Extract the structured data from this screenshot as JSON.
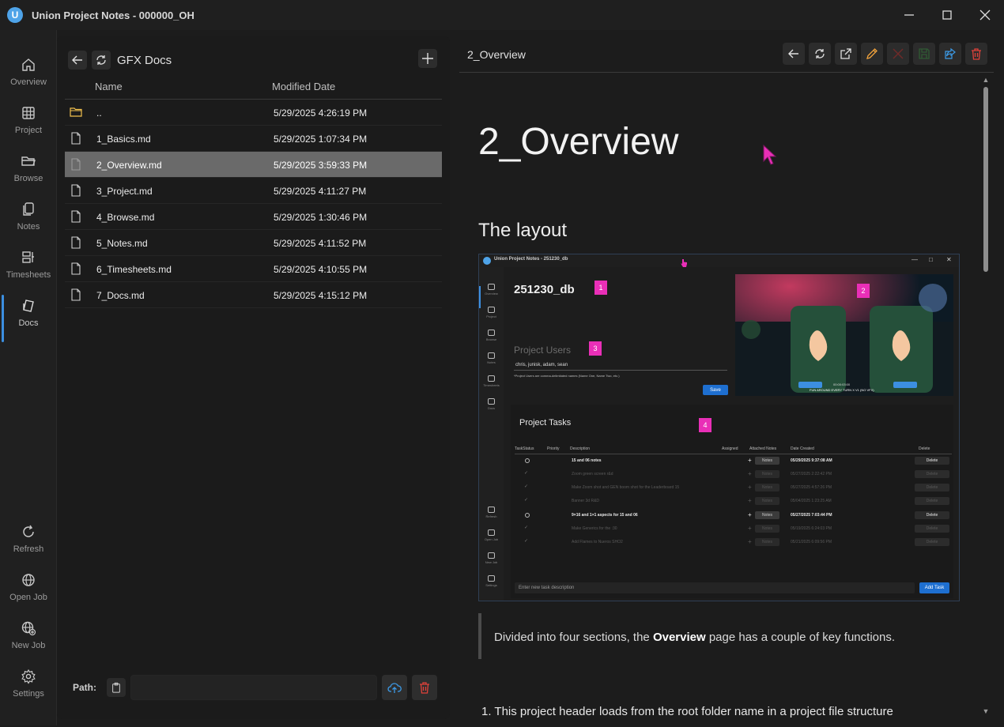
{
  "window": {
    "title": "Union Project Notes - 000000_OH",
    "logo_letter": "U"
  },
  "nav": [
    {
      "label": "Overview",
      "icon": "home-icon"
    },
    {
      "label": "Project",
      "icon": "grid-icon"
    },
    {
      "label": "Browse",
      "icon": "folder-open-icon"
    },
    {
      "label": "Notes",
      "icon": "notes-icon"
    },
    {
      "label": "Timesheets",
      "icon": "timesheets-icon"
    },
    {
      "label": "Docs",
      "icon": "docs-icon",
      "active": true
    },
    {
      "label": "Refresh",
      "icon": "refresh-icon"
    },
    {
      "label": "Open Job",
      "icon": "globe-icon"
    },
    {
      "label": "New Job",
      "icon": "globe-plus-icon"
    },
    {
      "label": "Settings",
      "icon": "gear-icon"
    }
  ],
  "files": {
    "folder_title": "GFX Docs",
    "columns": {
      "name": "Name",
      "modified": "Modified Date"
    },
    "rows": [
      {
        "name": "..",
        "modified": "5/29/2025 4:26:19 PM",
        "kind": "folder"
      },
      {
        "name": "1_Basics.md",
        "modified": "5/29/2025 1:07:34 PM",
        "kind": "file"
      },
      {
        "name": "2_Overview.md",
        "modified": "5/29/2025 3:59:33 PM",
        "kind": "file",
        "selected": true
      },
      {
        "name": "3_Project.md",
        "modified": "5/29/2025 4:11:27 PM",
        "kind": "file"
      },
      {
        "name": "4_Browse.md",
        "modified": "5/29/2025 1:30:46 PM",
        "kind": "file"
      },
      {
        "name": "5_Notes.md",
        "modified": "5/29/2025 4:11:52 PM",
        "kind": "file"
      },
      {
        "name": "6_Timesheets.md",
        "modified": "5/29/2025 4:10:55 PM",
        "kind": "file"
      },
      {
        "name": "7_Docs.md",
        "modified": "5/29/2025 4:15:12 PM",
        "kind": "file"
      }
    ],
    "path_label": "Path:",
    "path_value": ""
  },
  "doc": {
    "header_title": "2_Overview",
    "h1": "2_Overview",
    "h2": "The layout",
    "quote_pre": "Divided into four sections, the ",
    "quote_bold": "Overview",
    "quote_post": " page has a couple of key functions.",
    "list_item": "1.  This project header loads from the root folder name in a project file structure"
  },
  "shot": {
    "title": "Union Project Notes - 251230_db",
    "nav": [
      "Overview",
      "Project",
      "Browse",
      "Notes",
      "Timesheets",
      "Docs",
      "Refresh",
      "Open Job",
      "New Job",
      "Settings"
    ],
    "project": "251230_db",
    "users_label": "Project Users",
    "users_value": "chris, junisk, adam, sean",
    "users_hint": "*Project Users are comma-delimitated names (Name One, Name Two, etc.)",
    "save": "Save",
    "photo_caption": "FUN AROUND EVERY TURN X V1 (NO VFX)",
    "photo_timecode": "00:00:03:00",
    "tasks_title": "Project Tasks",
    "task_columns": [
      "TaskStatus",
      "Priority",
      "Description",
      "Assigned",
      "Attached Notes",
      "Date Created",
      "Delete"
    ],
    "tasks": [
      {
        "desc": "15 and 06 notes",
        "date": "05/29/2025 9:37:08 AM",
        "done": false
      },
      {
        "desc": "Zoom green screen r&d",
        "date": "05/27/2025 2:22:42 PM",
        "done": true
      },
      {
        "desc": "Make Zoom shot and GEN boom shot for the Leaderboard 15",
        "date": "05/27/2025 4:57:26 PM",
        "done": true
      },
      {
        "desc": "Banner 3d R&D",
        "date": "05/04/2025 1:23:25 AM",
        "done": true
      },
      {
        "desc": "9×16 and 1×1 aspects for 15 and 06",
        "date": "05/27/2025 7:03:44 PM",
        "done": false
      },
      {
        "desc": "Make Generics for the :30",
        "date": "05/19/2025 6:24:03 PM",
        "done": true
      },
      {
        "desc": "Add Flames to Nueros SHO2",
        "date": "05/21/2025 6:09:56 PM",
        "done": true
      }
    ],
    "notes_btn": "Notes",
    "delete_btn": "Delete",
    "new_task_placeholder": "Enter new task description",
    "add_task": "Add Task",
    "badges": [
      "1",
      "2",
      "3",
      "4"
    ]
  },
  "colors": {
    "accent": "#3c8fe0",
    "badge": "#e92fb7",
    "selected_row": "#6a6a6a",
    "delete_red": "#e0413a"
  }
}
